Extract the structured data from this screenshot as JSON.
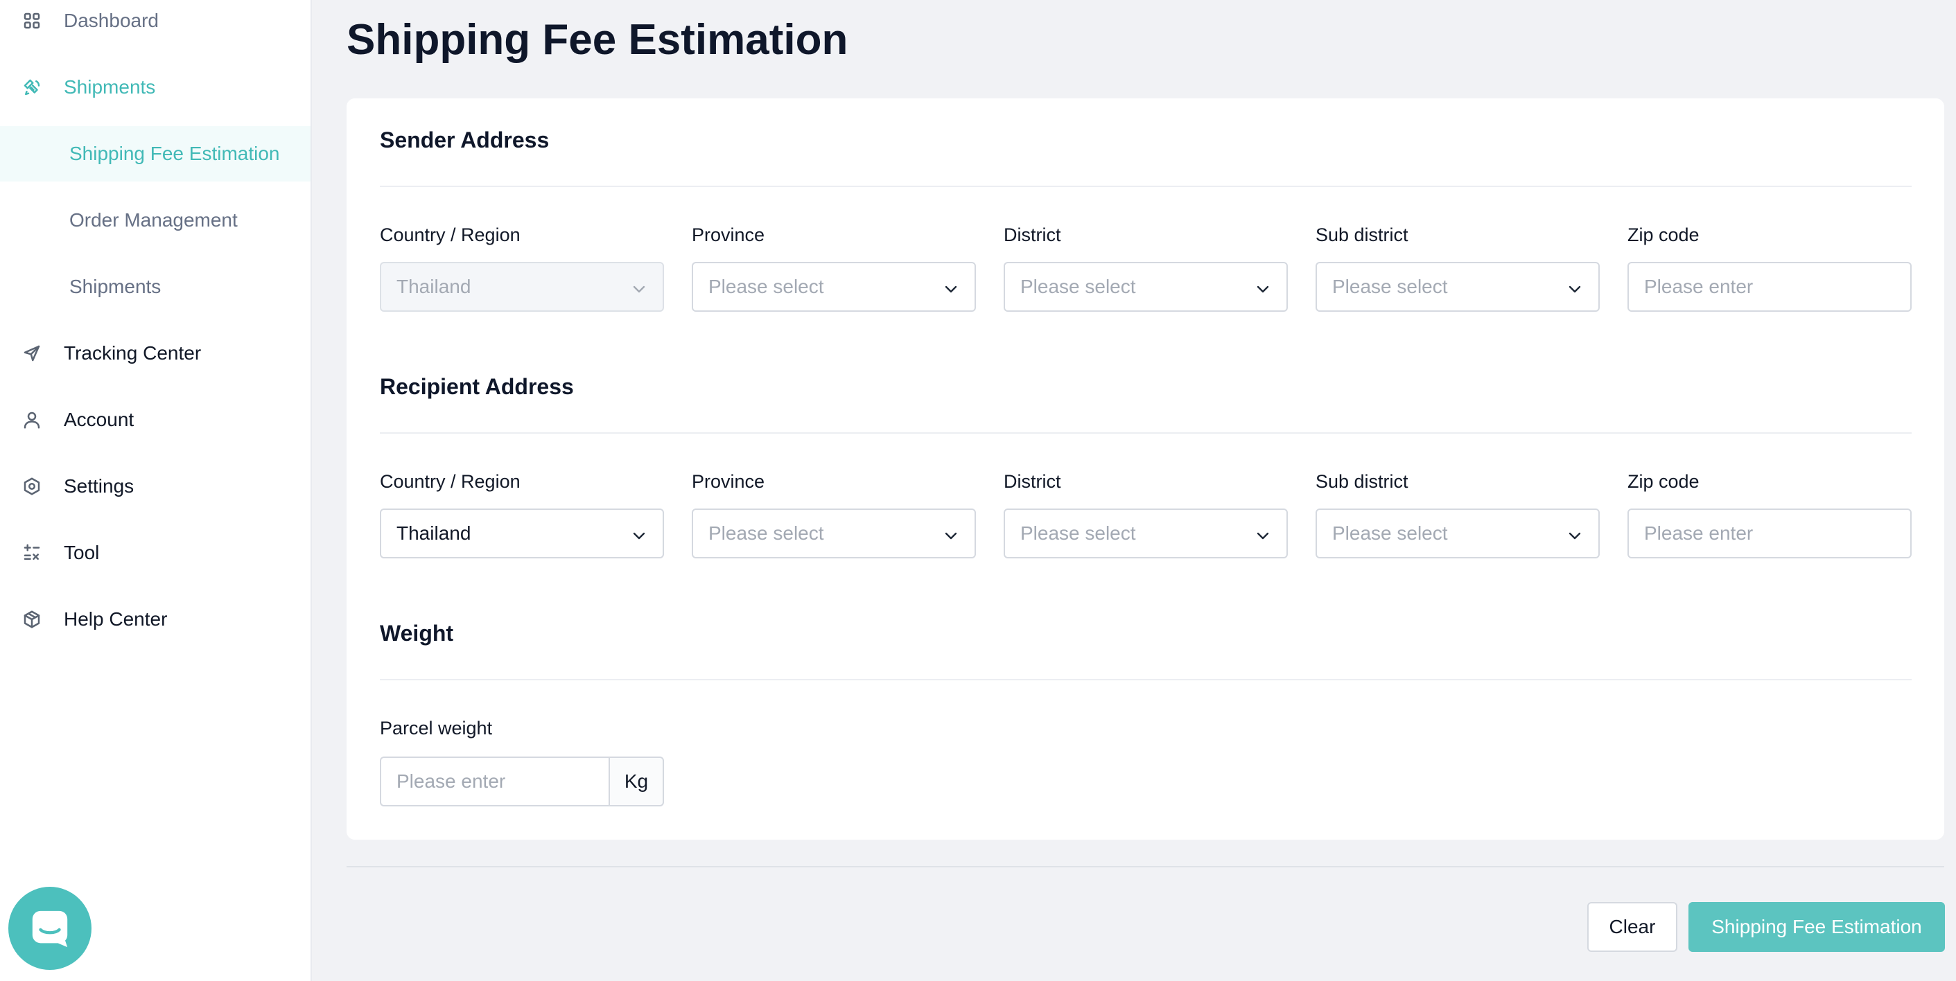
{
  "sidebar": {
    "items": [
      {
        "label": "Dashboard",
        "icon": "grid-icon"
      },
      {
        "label": "Shipments",
        "icon": "satellite-icon"
      },
      {
        "label": "Shipping Fee Estimation"
      },
      {
        "label": "Order Management"
      },
      {
        "label": "Shipments"
      },
      {
        "label": "Tracking Center",
        "icon": "send-icon"
      },
      {
        "label": "Account",
        "icon": "user-icon"
      },
      {
        "label": "Settings",
        "icon": "hexagon-gear-icon"
      },
      {
        "label": "Tool",
        "icon": "calculator-icon"
      },
      {
        "label": "Help Center",
        "icon": "cube-icon"
      }
    ],
    "chat_icon": "chat-icon"
  },
  "page": {
    "title": "Shipping Fee Estimation"
  },
  "sender": {
    "title": "Sender Address",
    "country_label": "Country / Region",
    "country_value": "Thailand",
    "province_label": "Province",
    "province_placeholder": "Please select",
    "district_label": "District",
    "district_placeholder": "Please select",
    "subdistrict_label": "Sub district",
    "subdistrict_placeholder": "Please select",
    "zip_label": "Zip code",
    "zip_placeholder": "Please enter"
  },
  "recipient": {
    "title": "Recipient Address",
    "country_label": "Country / Region",
    "country_value": "Thailand",
    "province_label": "Province",
    "province_placeholder": "Please select",
    "district_label": "District",
    "district_placeholder": "Please select",
    "subdistrict_label": "Sub district",
    "subdistrict_placeholder": "Please select",
    "zip_label": "Zip code",
    "zip_placeholder": "Please enter"
  },
  "weight": {
    "title": "Weight",
    "label": "Parcel weight",
    "placeholder": "Please enter",
    "unit": "Kg"
  },
  "actions": {
    "clear_label": "Clear",
    "submit_label": "Shipping Fee Estimation"
  },
  "colors": {
    "accent": "#41b9b6",
    "primary_button": "#5cc4c0",
    "background": "#f1f2f5"
  }
}
